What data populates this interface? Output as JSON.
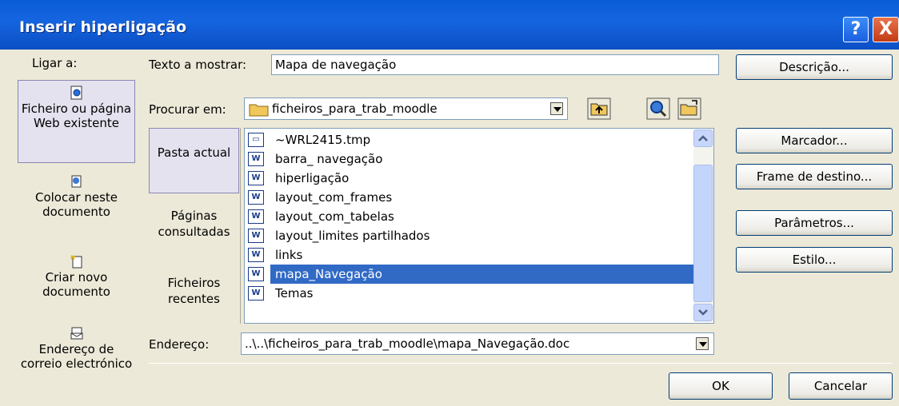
{
  "window": {
    "title": "Inserir hiperligação",
    "help_label": "?",
    "close_label": "X"
  },
  "link_to": {
    "label": "Ligar a:",
    "items": [
      {
        "label": "Ficheiro ou página Web existente",
        "icon": "file-web-icon",
        "selected": true
      },
      {
        "label": "Colocar neste documento",
        "icon": "document-place-icon",
        "selected": false
      },
      {
        "label": "Criar novo documento",
        "icon": "new-document-icon",
        "selected": false
      },
      {
        "label": "Endereço de correio electrónico",
        "icon": "email-icon",
        "selected": false
      }
    ]
  },
  "text_to_display": {
    "label": "Texto a mostrar:",
    "value": "Mapa de navegação"
  },
  "look_in": {
    "label": "Procurar em:",
    "value": "ficheiros_para_trab_moodle"
  },
  "toolbar": {
    "up_folder_icon": "up-folder-icon",
    "browse_web_icon": "browse-web-icon",
    "browse_file_icon": "browse-file-icon"
  },
  "nav": {
    "items": [
      {
        "label": "Pasta actual",
        "selected": true
      },
      {
        "label": "Páginas consultadas",
        "selected": false
      },
      {
        "label": "Ficheiros recentes",
        "selected": false
      }
    ]
  },
  "files": [
    {
      "name": "~WRL2415.tmp",
      "icon": "tmp-file-icon",
      "selected": false
    },
    {
      "name": "barra_ navegação",
      "icon": "word-doc-icon",
      "selected": false
    },
    {
      "name": "hiperligação",
      "icon": "word-doc-icon",
      "selected": false
    },
    {
      "name": "layout_com_frames",
      "icon": "word-doc-icon",
      "selected": false
    },
    {
      "name": "layout_com_tabelas",
      "icon": "word-doc-icon",
      "selected": false
    },
    {
      "name": "layout_limites partilhados",
      "icon": "word-doc-icon",
      "selected": false
    },
    {
      "name": "links",
      "icon": "word-doc-icon",
      "selected": false
    },
    {
      "name": "mapa_Navegação",
      "icon": "word-doc-icon",
      "selected": true
    },
    {
      "name": "Temas",
      "icon": "word-doc-icon",
      "selected": false
    }
  ],
  "address": {
    "label": "Endereço:",
    "value": "..\\..\\ficheiros_para_trab_moodle\\mapa_Navegação.doc"
  },
  "side_buttons": {
    "description": "Descrição...",
    "bookmark": "Marcador...",
    "target_frame": "Frame de destino...",
    "parameters": "Parâmetros...",
    "style": "Estilo..."
  },
  "footer": {
    "ok": "OK",
    "cancel": "Cancelar"
  },
  "colors": {
    "titlebar": "#0b5ad8",
    "selection": "#316ac5",
    "dialog_bg": "#ece9d8"
  }
}
